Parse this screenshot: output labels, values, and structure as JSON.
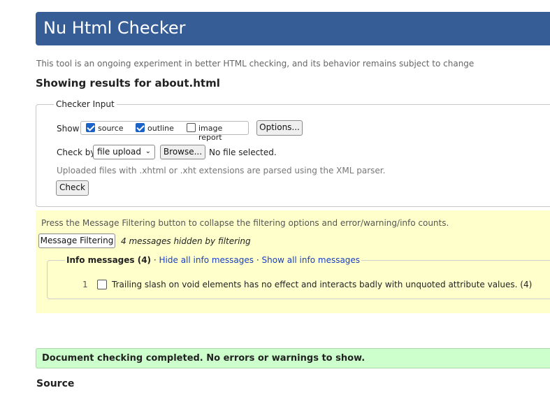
{
  "header": {
    "title": "Nu Html Checker"
  },
  "intro": "This tool is an ongoing experiment in better HTML checking, and its behavior remains subject to change",
  "results_heading": "Showing results for about.html",
  "checker_input": {
    "legend": "Checker Input",
    "show_label": "Show",
    "options": [
      {
        "label": "source",
        "checked": true
      },
      {
        "label": "outline",
        "checked": true
      },
      {
        "label": "image report",
        "checked": false
      }
    ],
    "options_button": "Options...",
    "check_by_label": "Check by",
    "check_by_value": "file upload",
    "browse_button": "Browse...",
    "file_status": "No file selected.",
    "xml_note": "Uploaded files with .xhtml or .xht extensions are parsed using the XML parser.",
    "check_button": "Check"
  },
  "filtering": {
    "note": "Press the Message Filtering button to collapse the filtering options and error/warning/info counts.",
    "button": "Message Filtering",
    "hidden_count": "4 messages hidden by filtering",
    "info": {
      "legend_label": "Info messages (4)",
      "sep": "·",
      "hide_link": "Hide all info messages",
      "show_link": "Show all info messages",
      "items": [
        {
          "num": "1",
          "text": "Trailing slash on void elements has no effect and interacts badly with unquoted attribute values. (4)"
        }
      ]
    }
  },
  "status": "Document checking completed. No errors or warnings to show.",
  "source_heading": "Source",
  "colors": {
    "header_bg": "#365d95",
    "filter_bg": "#ffffcc",
    "success_bg": "#ccffcc",
    "checkbox_on": "#1a62c8",
    "link": "#1a3fc4"
  }
}
